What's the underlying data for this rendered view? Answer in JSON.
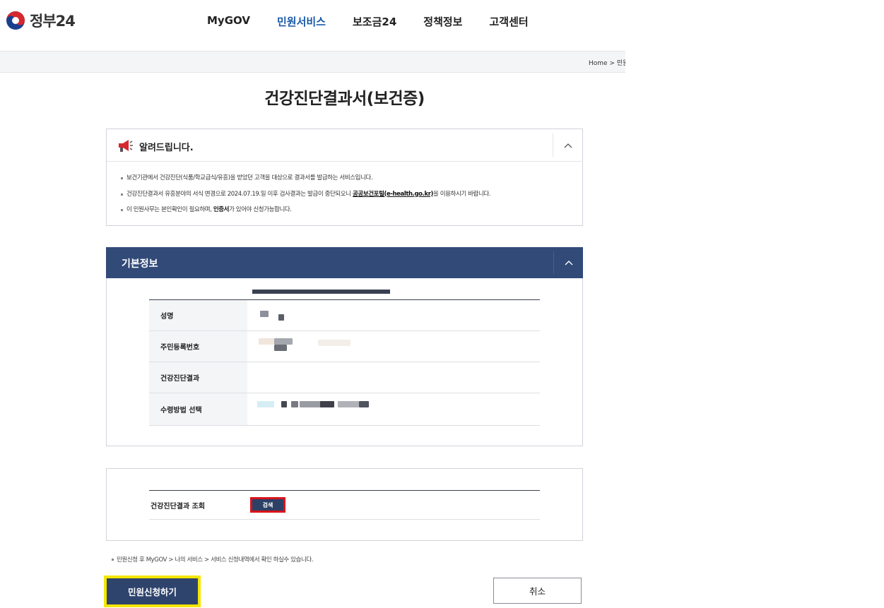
{
  "header": {
    "logo_text": "정부24",
    "nav": [
      "MyGOV",
      "민원서비스",
      "보조금24",
      "정책정보",
      "고객센터"
    ],
    "active_nav": "민원서비스"
  },
  "breadcrumb": {
    "home": "Home",
    "separator": ">",
    "current_partial": "민원"
  },
  "page_title": "건강진단결과서(보건증)",
  "notice": {
    "title": "알려드립니다.",
    "toggle_icon": "chevron-up-icon",
    "items": {
      "item1": "보건기관에서 건강진단(식품/학교급식/유흥)을 받았던 고객을 대상으로 결과서를 발급하는 서비스입니다.",
      "item2_pre": "건강진단결과서 유흥분야의 서식 변경으로 2024.07.19.일 이후 검사결과는 발급이 중단되오니 ",
      "item2_link": "공공보건포털(e-health.go.kr)",
      "item2_post": "을 이용하시기 바랍니다.",
      "item3_pre": "이 민원사무는 본인확인이 필요하며, ",
      "item3_bold": "인증서",
      "item3_post": "가 있어야 신청가능합니다."
    }
  },
  "basic_info": {
    "title": "기본정보",
    "toggle_icon": "chevron-up-icon",
    "rows": {
      "name": "성명",
      "resident_no": "주민등록번호",
      "result": "건강진단결과",
      "receive_method": "수령방법 선택"
    }
  },
  "search": {
    "label": "건강진단결과 조회",
    "button": "검색"
  },
  "footnote": "민원신청 후 MyGOV > 나의 서비스 > 서비스 신청내역에서 확인 하실수 있습니다.",
  "actions": {
    "apply": "민원신청하기",
    "cancel": "취소"
  },
  "colors": {
    "primary_navy": "#314a78",
    "active_nav": "#1b5aa8",
    "highlight_red": "#d8141c",
    "highlight_yellow": "#f5e600"
  }
}
